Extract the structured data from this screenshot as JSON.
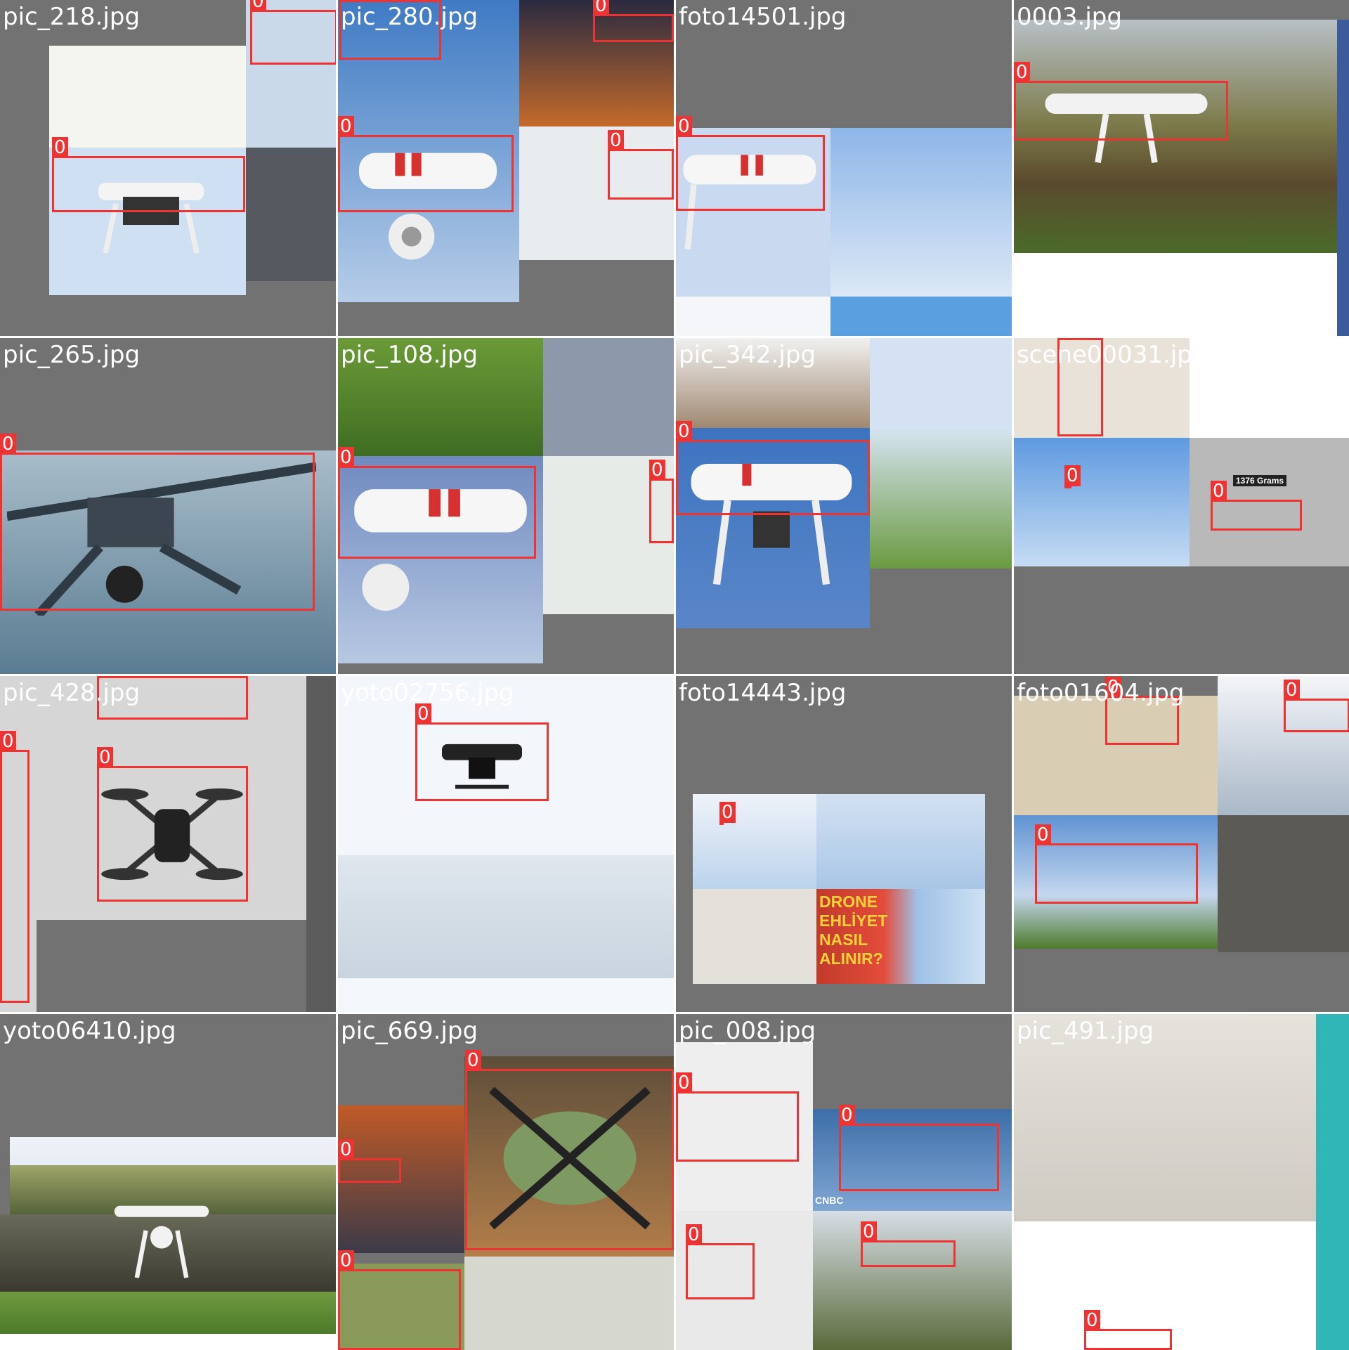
{
  "colors": {
    "box": "#ee3333",
    "box_text": "#ffffff",
    "label_text": "#ffffff",
    "pad": "#727272",
    "sky": "#b7cfe8",
    "deep_sky": "#4f86c8",
    "grass": "#4e7a2c",
    "sunset": "#c66a2a",
    "white": "#f3f3f3"
  },
  "class_label": "0",
  "tiles": [
    {
      "label": "pic_218.jpg",
      "boxes": 2
    },
    {
      "label": "pic_280.jpg",
      "boxes": 4
    },
    {
      "label": "foto14501.jpg",
      "boxes": 2
    },
    {
      "label": "0003.jpg",
      "boxes": 2
    },
    {
      "label": "pic_265.jpg",
      "boxes": 1
    },
    {
      "label": "pic_108.jpg",
      "boxes": 2
    },
    {
      "label": "pic_342.jpg",
      "boxes": 1
    },
    {
      "label": "scene00031.jpg",
      "boxes": 3
    },
    {
      "label": "pic_428.jpg",
      "boxes": 3
    },
    {
      "label": "yoto02756.jpg",
      "boxes": 1
    },
    {
      "label": "foto14443.jpg",
      "boxes": 1
    },
    {
      "label": "foto01604.jpg",
      "boxes": 3
    },
    {
      "label": "yoto06410.jpg",
      "boxes": 0
    },
    {
      "label": "pic_669.jpg",
      "boxes": 3
    },
    {
      "label": "pic_008.jpg",
      "boxes": 4
    },
    {
      "label": "pic_491.jpg",
      "boxes": 1
    }
  ],
  "banners": {
    "drone_license": [
      "DRONE",
      "EHLİYET",
      "NASIL",
      "ALINIR?"
    ],
    "weight_caption": "1376 Grams",
    "network_logo": "CNBC"
  },
  "icons": [
    "drone-icon",
    "palm-tree-icon",
    "play-icon"
  ]
}
